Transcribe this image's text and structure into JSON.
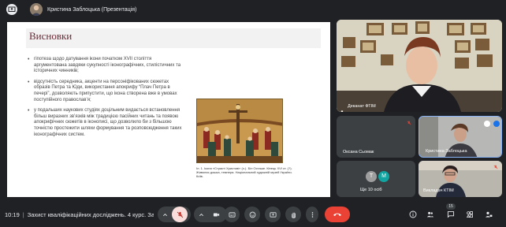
{
  "presenter": {
    "label": "Кристина Заблоцька (Презентація)"
  },
  "slide": {
    "title": "Висновки",
    "bullets": [
      "гіпотеза щодо датування ікони початком XVII століття аргументована завдяки сукупності іконографічних, стилістичних та історичних чинників;",
      "відсутність середника, акценти на персоніфікованих сюжетах образів Петра та Юди, використання апокрифу “Плач Петра в печері”, дозволяють припустити, що ікона створена вже в умовах поступійного православ’я;",
      "у подальших наукових студіях доцільним видається встановлення більш виразних зв’язків між традицією пасійних читань та появою апокрифічних сюжетів в іконописі, що дозволило би з більшою точністю простежити шляхи формування та розповсюдження таких іконографічних систем."
    ],
    "caption": "Іл. 1. Ікона «Страсті Христові» (ч.). Біл Осташе. Кінець XVI ст. (?). Живопис дошка, темпера. Національний художній музей України. Київ."
  },
  "participants": {
    "dekanat": "Деканат ФТІМ",
    "oksana": "Оксана Сьомак",
    "kristina": "Кристина Заблоцька",
    "others_label": "Ще 10 осіб",
    "others_initials": [
      "T",
      "M"
    ],
    "vykladach": "Викладач КТІМ"
  },
  "bottom": {
    "time": "10:19",
    "separator": "|",
    "meeting_title": "Захист кваліфікаційних досліджень. 4 курс. Зао...",
    "participant_count": "15"
  },
  "colors": {
    "end_call": "#ea4335",
    "mic_off": "#ea4335",
    "accent_tile_border": "#8ab4f8",
    "slide_title": "#6b2a36"
  }
}
